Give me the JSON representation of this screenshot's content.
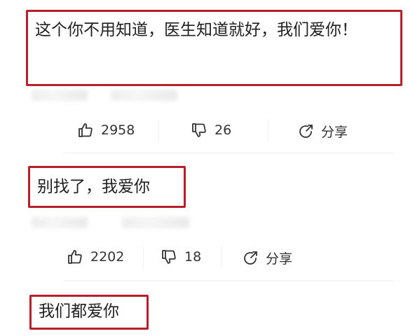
{
  "comments": [
    {
      "text": "这个你不用知道，医生知道就好，我们爱你！",
      "likes": "2958",
      "dislikes": "26",
      "share_label": "分享"
    },
    {
      "text": "别找了，我爱你",
      "likes": "2202",
      "dislikes": "18",
      "share_label": "分享"
    },
    {
      "text": "我们都爱你"
    }
  ],
  "colors": {
    "highlight_border": "#b5202a",
    "text": "#1f1f1f",
    "icon": "#333333"
  },
  "icons": [
    "thumbs-up-icon",
    "thumbs-down-icon",
    "share-icon"
  ]
}
